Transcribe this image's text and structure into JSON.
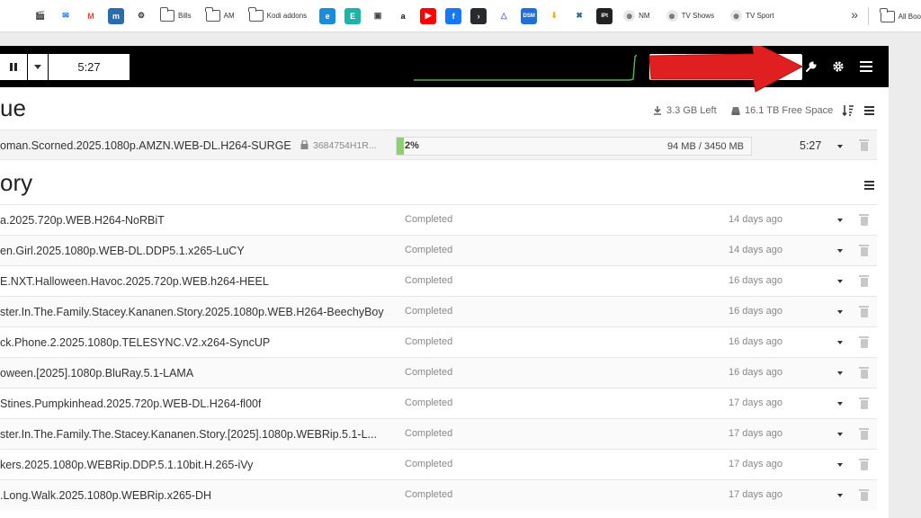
{
  "bookmarks": [
    {
      "kind": "icon",
      "icon": "film-icon",
      "color": "#ffffff"
    },
    {
      "kind": "icon",
      "icon": "clapperboard-icon",
      "color": "#ffffff"
    },
    {
      "kind": "icon",
      "icon": "mail-icon",
      "color": "#1a73e8"
    },
    {
      "kind": "icon",
      "icon": "gmail-icon",
      "color": "#ea4335"
    },
    {
      "kind": "icon",
      "icon": "m-app-icon",
      "color": "#2b6cb0"
    },
    {
      "kind": "icon",
      "icon": "openai-icon",
      "color": "#333333"
    },
    {
      "kind": "folder",
      "label": "Bills"
    },
    {
      "kind": "folder",
      "label": "AM"
    },
    {
      "kind": "folder",
      "label": "Kodi addons"
    },
    {
      "kind": "icon",
      "icon": "edge-icon",
      "color": "#1b8dd8"
    },
    {
      "kind": "icon",
      "icon": "e-app-icon",
      "color": "#1db4a7"
    },
    {
      "kind": "icon",
      "icon": "store-icon",
      "color": "#444444"
    },
    {
      "kind": "icon",
      "icon": "amazon-icon",
      "color": "#111111"
    },
    {
      "kind": "icon",
      "icon": "youtube-icon",
      "color": "#ff0000"
    },
    {
      "kind": "icon",
      "icon": "facebook-icon",
      "color": "#1877f2"
    },
    {
      "kind": "icon",
      "icon": "plex-icon",
      "color": "#282a2d"
    },
    {
      "kind": "icon",
      "icon": "triangle-app-icon",
      "color": "#4f7bd9"
    },
    {
      "kind": "icon",
      "icon": "dsm-icon",
      "color": "#1e6fd9"
    },
    {
      "kind": "icon",
      "icon": "download-arrow-icon",
      "color": "#f3b21a"
    },
    {
      "kind": "icon",
      "icon": "cross-app-icon",
      "color": "#2c6e9b"
    },
    {
      "kind": "icon",
      "icon": "iptv-icon",
      "color": "#222222"
    },
    {
      "kind": "site",
      "label": "NM"
    },
    {
      "kind": "site",
      "label": "TV Shows"
    },
    {
      "kind": "site",
      "label": "TV Sport"
    }
  ],
  "bookmarks_more": "»",
  "bookmarks_all": "All Boo",
  "topbar": {
    "time_left": "5:27"
  },
  "queue": {
    "title": "ue",
    "left_text": "3.3 GB Left",
    "free_space": "16.1 TB Free Space",
    "item": {
      "name": "oman.Scorned.2025.1080p.AMZN.WEB-DL.H264-SURGE",
      "password": "3684754H1R...",
      "percent_text": "2%",
      "percent": 2,
      "size": "94 MB / 3450 MB",
      "time": "5:27"
    }
  },
  "history": {
    "title": "ory",
    "items": [
      {
        "name": "a.2025.720p.WEB.H264-NoRBiT",
        "status": "Completed",
        "age": "14 days ago"
      },
      {
        "name": "en.Girl.2025.1080p.WEB-DL.DDP5.1.x265-LuCY",
        "status": "Completed",
        "age": "14 days ago"
      },
      {
        "name": "E.NXT.Halloween.Havoc.2025.720p.WEB.h264-HEEL",
        "status": "Completed",
        "age": "16 days ago"
      },
      {
        "name": "ster.In.The.Family.Stacey.Kananen.Story.2025.1080p.WEB.H264-BeechyBoy",
        "status": "Completed",
        "age": "16 days ago"
      },
      {
        "name": "ck.Phone.2.2025.1080p.TELESYNC.V2.x264-SyncUP",
        "status": "Completed",
        "age": "16 days ago"
      },
      {
        "name": "oween.[2025].1080p.BluRay.5.1-LAMA",
        "status": "Completed",
        "age": "16 days ago"
      },
      {
        "name": "Stines.Pumpkinhead.2025.720p.WEB-DL.H264-fl00f",
        "status": "Completed",
        "age": "17 days ago"
      },
      {
        "name": "ster.In.The.Family.The.Stacey.Kananen.Story.[2025].1080p.WEBRip.5.1-L...",
        "status": "Completed",
        "age": "17 days ago"
      },
      {
        "name": "kers.2025.1080p.WEBRip.DDP.5.1.10bit.H.265-iVy",
        "status": "Completed",
        "age": "17 days ago"
      },
      {
        "name": ".Long.Walk.2025.1080p.WEBRip.x265-DH",
        "status": "Completed",
        "age": "17 days ago"
      }
    ]
  },
  "colors": {
    "topbar": "#000000",
    "progress_fill": "#8fcf6f",
    "annotation_arrow": "#e02020",
    "speed_line": "#4caf50"
  }
}
